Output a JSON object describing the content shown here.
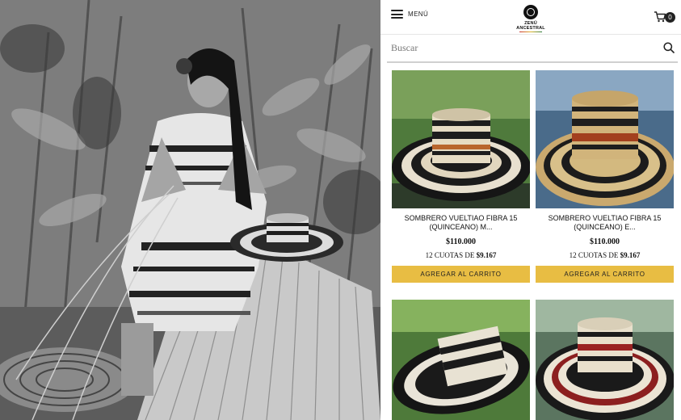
{
  "header": {
    "menu_label": "MENÚ",
    "logo_text": "ZENÚ ANCESTRAL",
    "cart_count": "0"
  },
  "search": {
    "placeholder": "Buscar"
  },
  "products": [
    {
      "name": "SOMBRERO VUELTIAO FIBRA 15 (QUINCEANO) M...",
      "price": "$110.000",
      "installments_prefix": "12 CUOTAS DE",
      "installment_amount": "$9.167",
      "button_label": "AGREGAR AL CARRITO"
    },
    {
      "name": "SOMBRERO VUELTIAO FIBRA 15 (QUINCEANO) E...",
      "price": "$110.000",
      "installments_prefix": "12 CUOTAS DE",
      "installment_amount": "$9.167",
      "button_label": "AGREGAR AL CARRITO"
    },
    {},
    {}
  ],
  "colors": {
    "accent_button": "#e8bd43",
    "text": "#111111"
  },
  "icons": {
    "menu": "hamburger-icon",
    "cart": "cart-icon",
    "search": "search-icon"
  }
}
